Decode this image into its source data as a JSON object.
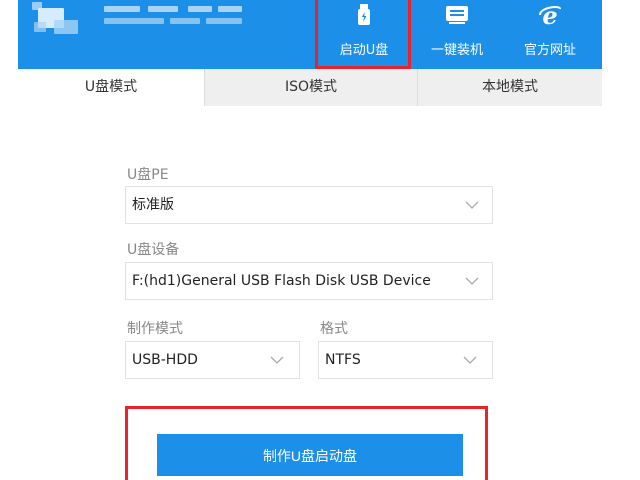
{
  "toolbar": {
    "items": [
      {
        "label": "启动U盘",
        "icon": "usb-drive-icon"
      },
      {
        "label": "一键装机",
        "icon": "system-install-icon"
      },
      {
        "label": "官方网址",
        "icon": "ie-browser-icon"
      }
    ],
    "bg_color": "#1c8fe8"
  },
  "tabs": [
    {
      "label": "U盘模式",
      "active": true
    },
    {
      "label": "ISO模式",
      "active": false
    },
    {
      "label": "本地模式",
      "active": false
    }
  ],
  "form": {
    "pe_label": "U盘PE",
    "pe_value": "标准版",
    "device_label": "U盘设备",
    "device_value": "F:(hd1)General USB Flash Disk USB Device",
    "mode_label": "制作模式",
    "mode_value": "USB-HDD",
    "format_label": "格式",
    "format_value": "NTFS"
  },
  "action": {
    "make_button_label": "制作U盘启动盘"
  },
  "highlight_color": "#e8232b"
}
